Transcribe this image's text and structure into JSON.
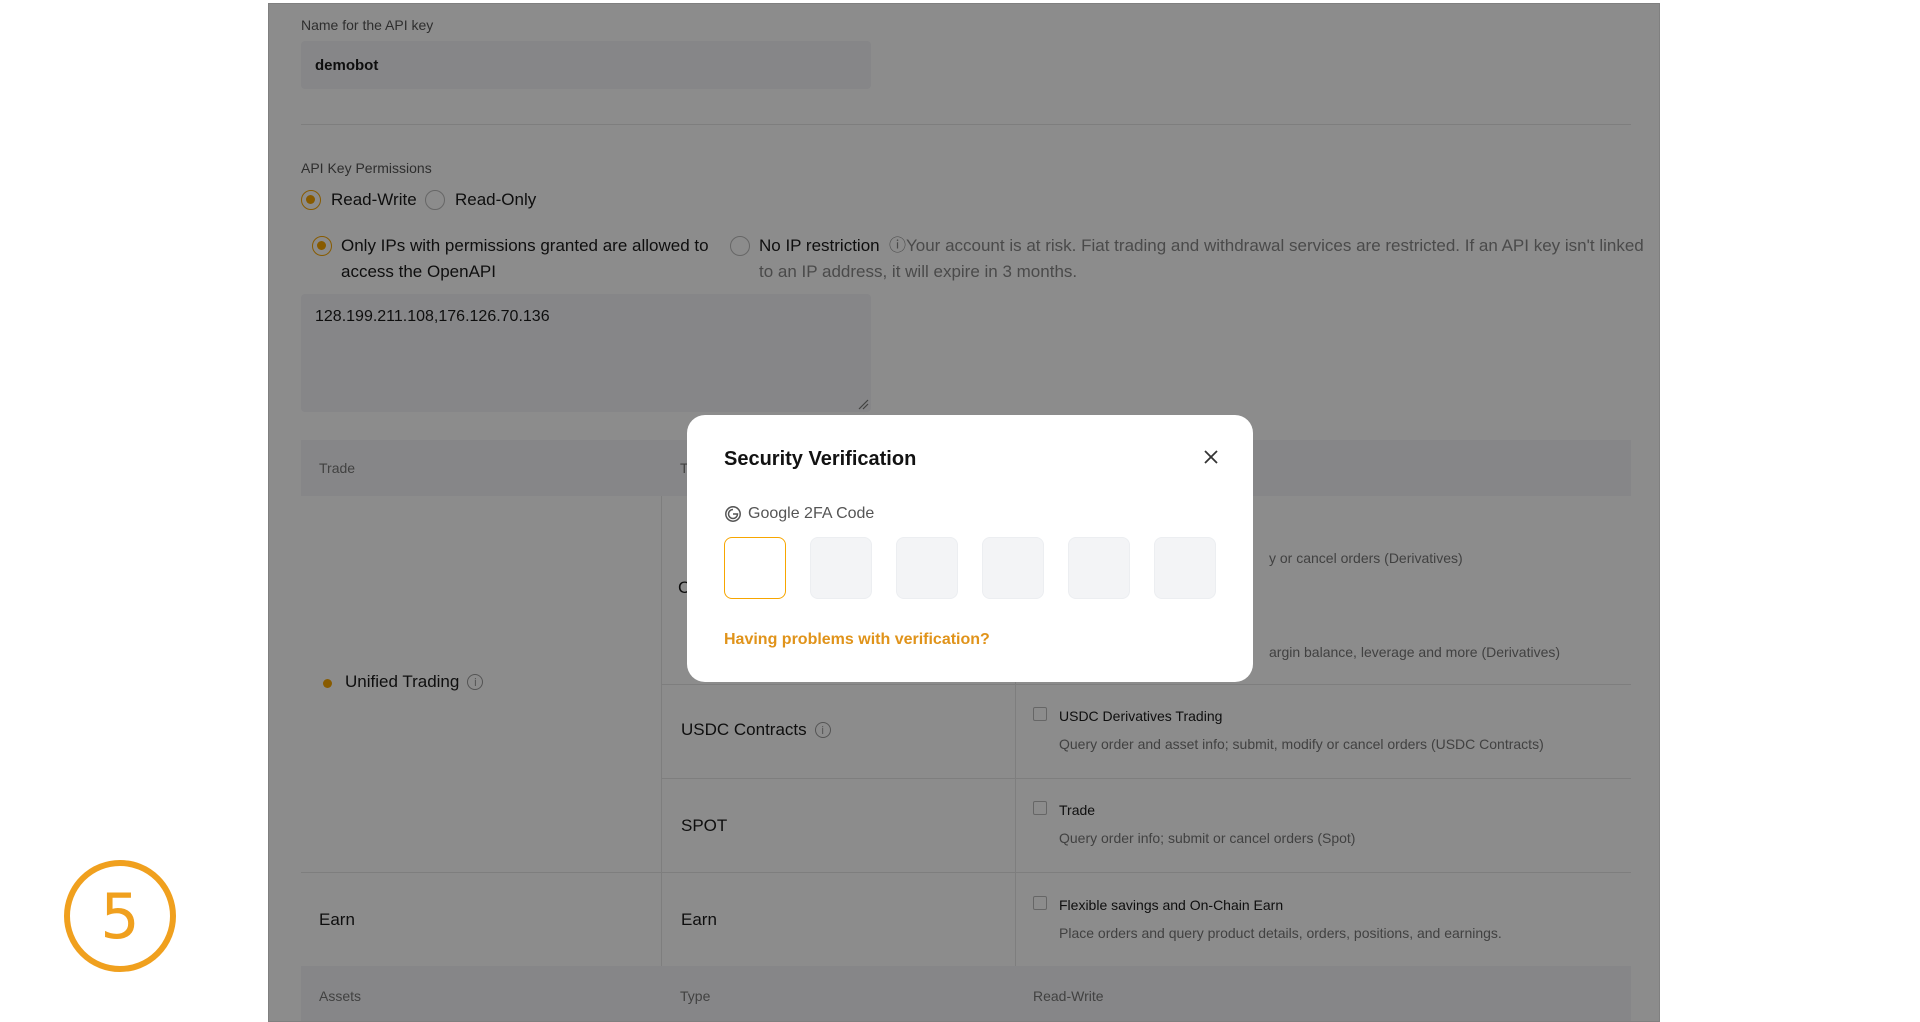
{
  "step": {
    "number": "5"
  },
  "form": {
    "name_label": "Name for the API key",
    "name_value": "demobot",
    "permissions_label": "API Key Permissions",
    "access": {
      "read_write": "Read-Write",
      "read_only": "Read-Only",
      "selected": "Read-Write"
    },
    "ip_option_label_line1": "Only IPs with permissions granted are allowed to",
    "ip_option_label_line2": "access the OpenAPI",
    "no_ip_label": "No IP restriction",
    "warning_line1": "ⓘYour account is at risk. Fiat trading and withdrawal services are restricted. If an API key isn't linked",
    "warning_line2": "to an IP address, it will expire in 3 months.",
    "ip_value": "128.199.211.108,176.126.70.136"
  },
  "table": {
    "header1": {
      "col1": "Trade",
      "col2": "T"
    },
    "unified": "Unified Trading",
    "partial_left": "C",
    "partial_orders": "y or cancel orders (Derivatives)",
    "partial_margin": "argin balance, leverage and more (Derivatives)",
    "usdc": {
      "label": "USDC Contracts",
      "perm_title": "USDC Derivatives Trading",
      "perm_desc": "Query order and asset info; submit, modify or cancel orders (USDC Contracts)"
    },
    "spot": {
      "label": "SPOT",
      "perm_title": "Trade",
      "perm_desc": "Query order info; submit or cancel orders (Spot)"
    },
    "earn": {
      "label": "Earn",
      "type": "Earn",
      "perm_title": "Flexible savings and On-Chain Earn",
      "perm_desc": "Place orders and query product details, orders, positions, and earnings."
    },
    "header2": {
      "col1": "Assets",
      "col2": "Type",
      "col3": "Read-Write"
    }
  },
  "modal": {
    "title": "Security Verification",
    "ga_label": "Google 2FA Code",
    "code_digits": [
      "",
      "",
      "",
      "",
      "",
      ""
    ],
    "help_link": "Having problems with verification?"
  },
  "colors": {
    "accent": "#f7a600",
    "step_badge": "#f0a01e",
    "link": "#e0931a"
  }
}
